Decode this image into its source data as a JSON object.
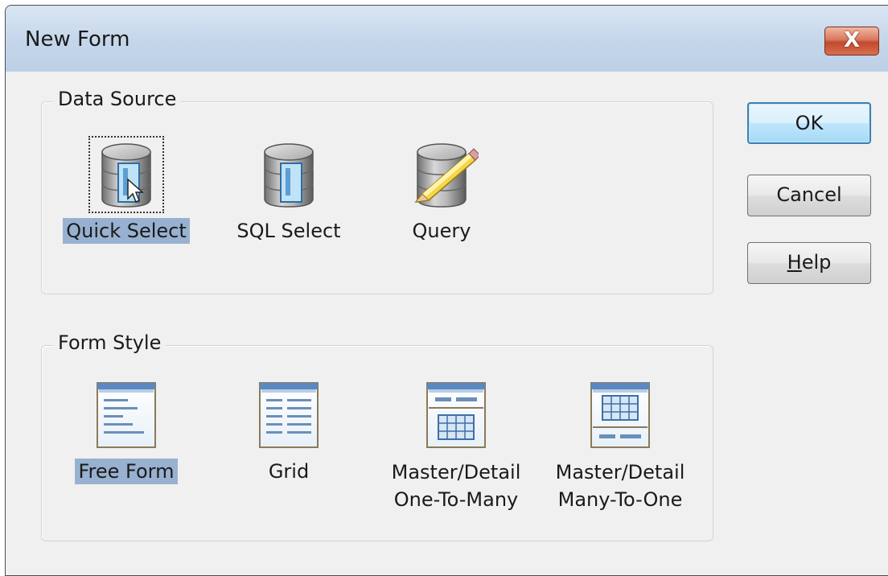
{
  "window": {
    "title": "New Form",
    "close_label": "X"
  },
  "data_source": {
    "label": "Data Source",
    "items": [
      {
        "label": "Quick Select",
        "icon": "database-form-icon",
        "selected": true
      },
      {
        "label": "SQL Select",
        "icon": "database-form-icon",
        "selected": false
      },
      {
        "label": "Query",
        "icon": "database-pencil-icon",
        "selected": false
      }
    ]
  },
  "form_style": {
    "label": "Form Style",
    "items": [
      {
        "label": "Free Form",
        "icon": "free-form-icon",
        "selected": true
      },
      {
        "label": "Grid",
        "icon": "grid-form-icon",
        "selected": false
      },
      {
        "label": "Master/Detail One-To-Many",
        "line1": "Master/Detail",
        "line2": "One-To-Many",
        "icon": "master-detail-one-to-many-icon",
        "selected": false
      },
      {
        "label": "Master/Detail Many-To-One",
        "line1": "Master/Detail",
        "line2": "Many-To-One",
        "icon": "master-detail-many-to-one-icon",
        "selected": false
      }
    ]
  },
  "buttons": {
    "ok": "OK",
    "cancel": "Cancel",
    "help_first": "H",
    "help_rest": "elp"
  },
  "colors": {
    "selection": "#98b1d0",
    "title_bar": "#c5d6ea",
    "close_button": "#c24a2e",
    "default_button_border": "#3c7fb1"
  }
}
